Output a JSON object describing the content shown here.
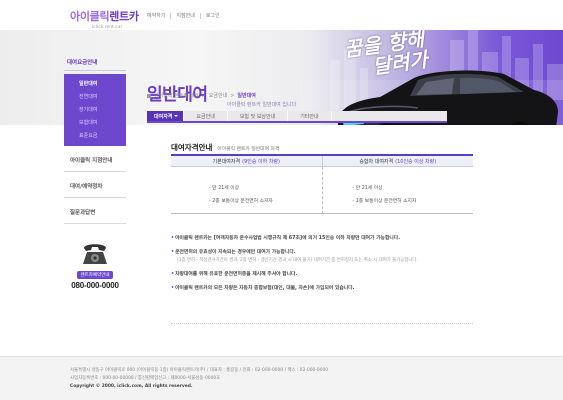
{
  "header": {
    "logo_text_a": "아이클릭",
    "logo_text_b": "렌트카",
    "logo_domain": "iclick.rent.car",
    "nav": [
      "예약하기",
      "지점안내",
      "로그인"
    ]
  },
  "hero": {
    "slogan_line1": "꿈을 향해",
    "slogan_line2": "달려가",
    "page_title": "일반대여",
    "page_subtitle": "아이클릭 렌트카 일반대여 입니다",
    "breadcrumb": [
      "아이클릭 렌트카 메인",
      "요금안내",
      "일반대여"
    ]
  },
  "sidebar": {
    "head": "대여요금안내",
    "sub_items": [
      {
        "label": "일반대여",
        "active": true
      },
      {
        "label": "전연대여",
        "active": false
      },
      {
        "label": "장기대여",
        "active": false
      },
      {
        "label": "보험대여",
        "active": false
      },
      {
        "label": "표준요금",
        "active": false
      }
    ],
    "links": [
      "아이클릭 지점안내",
      "대여/예약정차",
      "질문과답변"
    ],
    "phone_tag": "렌트카예약안내",
    "phone_number": "080-000-0000"
  },
  "tabs": {
    "active_label": "대여자격",
    "items": [
      "요금안내",
      "보험 및 보상안내",
      "기타안내"
    ]
  },
  "section": {
    "title": "대여자격안내",
    "description": "아이클릭 렌트카 일반대여 자격"
  },
  "qualification_table": {
    "headers": [
      {
        "label": "기본대여자격",
        "note": "(9인승 이하 차량)"
      },
      {
        "label": "승합차 대여자격",
        "note": "(10인승 이상 차량)"
      }
    ],
    "columns": [
      [
        "- 만 21세 이상",
        "- 2종 보통이상 운전면허 소지자"
      ],
      [
        "- 만 21세 이상",
        "- 1종 보통이상 운전면허 소지자"
      ]
    ]
  },
  "notes": [
    {
      "text": "아이클릭 렌트카는 [여객자동차 운수사업법 시행규칙 제 67조]에 의거 15인승 이하 차량만 대여가 가능합니다.",
      "sub": ""
    },
    {
      "text": "운전면허의 유효성이 지속되는 경우에만 대여가 가능합니다.",
      "sub": "(1종 면허 - 적성검사기간이 경과, 2종 면허 - 갱신기간 경과 시 대여 불가) 대여기간 중 면허정지 또는 취소 시 대여가 불가능합니다."
    },
    {
      "text": "차량대여를 위해 유효한 운전면허증을 제시해 주셔야 합니다.",
      "sub": ""
    },
    {
      "text": "아이클릭 렌트카의 모든 차량은 자동차 종합보험(대인, 대물, 자손)에 가입되어 있습니다.",
      "sub": ""
    }
  ],
  "footer": {
    "lines": [
      "서울특별시 성동구 아이클릭로 000 (아이클릭동 1층) 아이클릭렌트카(주) / 대표자 : 홍길동 / 전화 : 02-000-0000 / 팩스 : 02-000-0000",
      "사업자등록번호 : 000-00-00000 / 통신판매업신고 : 제0000-서울성동-0000호"
    ],
    "copyright": "Copyright © 2000, iclick.com, All rights reserved."
  },
  "colors": {
    "brand_purple": "#6d48cf",
    "tab_active": "#5733b5",
    "accent_text": "#6a3cc8"
  }
}
